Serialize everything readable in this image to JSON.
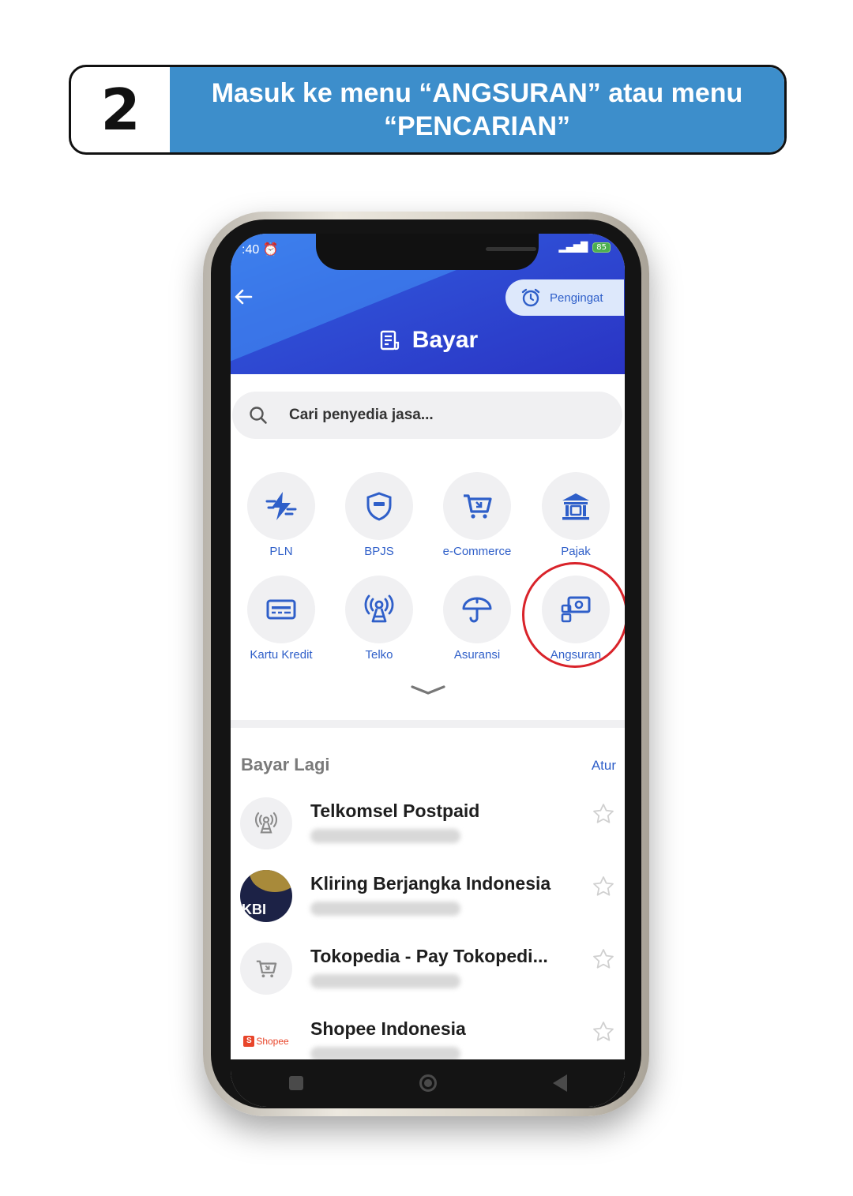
{
  "banner": {
    "step_number": "2",
    "line1": "Masuk ke menu “ANGSURAN” atau menu",
    "line2": "“PENCARIAN”"
  },
  "status_bar": {
    "time": ":40",
    "battery": "85"
  },
  "header": {
    "reminder_label": "Pengingat",
    "title": "Bayar"
  },
  "search": {
    "placeholder": "Cari penyedia jasa..."
  },
  "categories": [
    {
      "label": "PLN",
      "icon": "lightning-icon"
    },
    {
      "label": "BPJS",
      "icon": "shield-icon"
    },
    {
      "label": "e-Commerce",
      "icon": "cart-icon"
    },
    {
      "label": "Pajak",
      "icon": "bank-icon"
    },
    {
      "label": "Kartu Kredit",
      "icon": "credit-card-icon"
    },
    {
      "label": "Telko",
      "icon": "tower-icon"
    },
    {
      "label": "Asuransi",
      "icon": "umbrella-icon"
    },
    {
      "label": "Angsuran",
      "icon": "installment-icon"
    }
  ],
  "bayar_lagi": {
    "title": "Bayar Lagi",
    "action": "Atur",
    "items": [
      {
        "name": "Telkomsel Postpaid",
        "icon": "tower-icon"
      },
      {
        "name": "Kliring Berjangka Indonesia",
        "logo_text": "KBI"
      },
      {
        "name": "Tokopedia - Pay Tokopedi...",
        "icon": "cart-icon"
      },
      {
        "name": "Shopee Indonesia",
        "logo_text": "Shopee"
      }
    ]
  },
  "colors": {
    "accent": "#2f5fc9",
    "banner": "#3d8ecb",
    "highlight": "#d9232a"
  }
}
